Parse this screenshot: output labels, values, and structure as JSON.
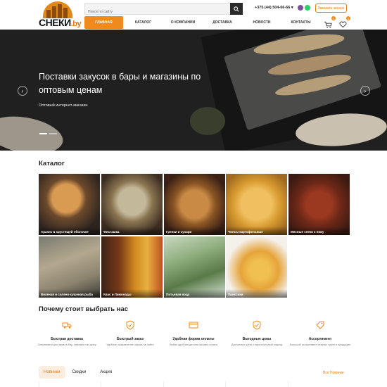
{
  "header": {
    "logo_text": "СНЕКИ",
    "logo_domain": ".by",
    "search_placeholder": "Поиск по сайту",
    "phone": "+375 (44) 504-66-66",
    "order_call": "Заказать звонок",
    "nav": [
      "Главная",
      "Каталог",
      "О компании",
      "Доставка",
      "Новости",
      "Контакты"
    ],
    "cart_count": "0",
    "fav_count": "0"
  },
  "hero": {
    "title": "Поставки закусок в бары и магазины по оптовым ценам",
    "subtitle": "Оптовый интернет-магазин",
    "slides": 2,
    "active_slide": 1
  },
  "catalog": {
    "title": "Каталог",
    "items": [
      {
        "label": "Арахис в хрустящей оболочке"
      },
      {
        "label": "Фисташка"
      },
      {
        "label": "Гренки и сухари"
      },
      {
        "label": "Чипсы картофельные"
      },
      {
        "label": "Мясные снеки к пиву"
      },
      {
        "label": "Вяленая и солено-сушеная рыба"
      },
      {
        "label": "Квас и Лимонады"
      },
      {
        "label": "Питьевая вода"
      },
      {
        "label": "Приссики"
      }
    ]
  },
  "why": {
    "title": "Почему стоит выбрать нас",
    "items": [
      {
        "title": "Быстрая доставка",
        "desc": "Оперативно доставим в бар, магазин или дому"
      },
      {
        "title": "Быстрый заказ",
        "desc": "Удобное оформление заказа на сайте"
      },
      {
        "title": "Удобная форма оплаты",
        "desc": "Любая удобная для вас форма оплаты"
      },
      {
        "title": "Выгодные цены",
        "desc": "Доступные цены к персональный подход"
      },
      {
        "title": "Ассортимент",
        "desc": "Большой ассортимент пивных групп и продукции"
      }
    ]
  },
  "tabs": {
    "items": [
      "Новинки",
      "Скидки",
      "Акция"
    ],
    "all_link": "Все Новинки"
  },
  "colors": {
    "accent": "#f08a1c",
    "dark": "#202020"
  }
}
